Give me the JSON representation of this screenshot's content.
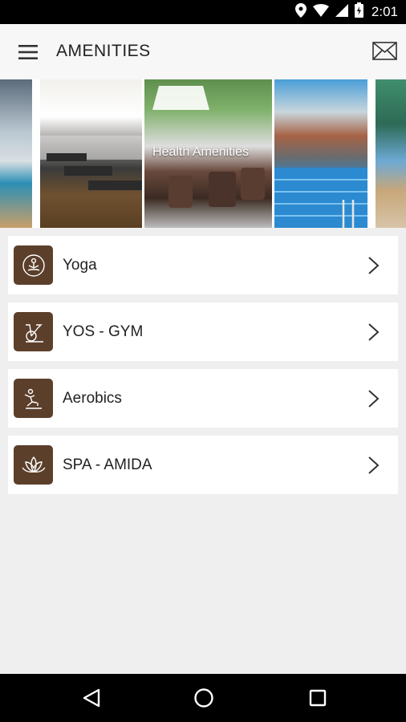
{
  "status_bar": {
    "time": "2:01"
  },
  "app_bar": {
    "title": "AMENITIES"
  },
  "carousel": {
    "caption": "Health Amenities"
  },
  "amenities": [
    {
      "label": "Yoga",
      "icon": "yoga-icon"
    },
    {
      "label": "YOS - GYM",
      "icon": "exercise-bike-icon"
    },
    {
      "label": "Aerobics",
      "icon": "aerobics-icon"
    },
    {
      "label": "SPA - AMIDA",
      "icon": "lotus-icon"
    }
  ],
  "colors": {
    "icon_tile": "#5b3f2b",
    "background": "#efefef",
    "card": "#ffffff"
  }
}
